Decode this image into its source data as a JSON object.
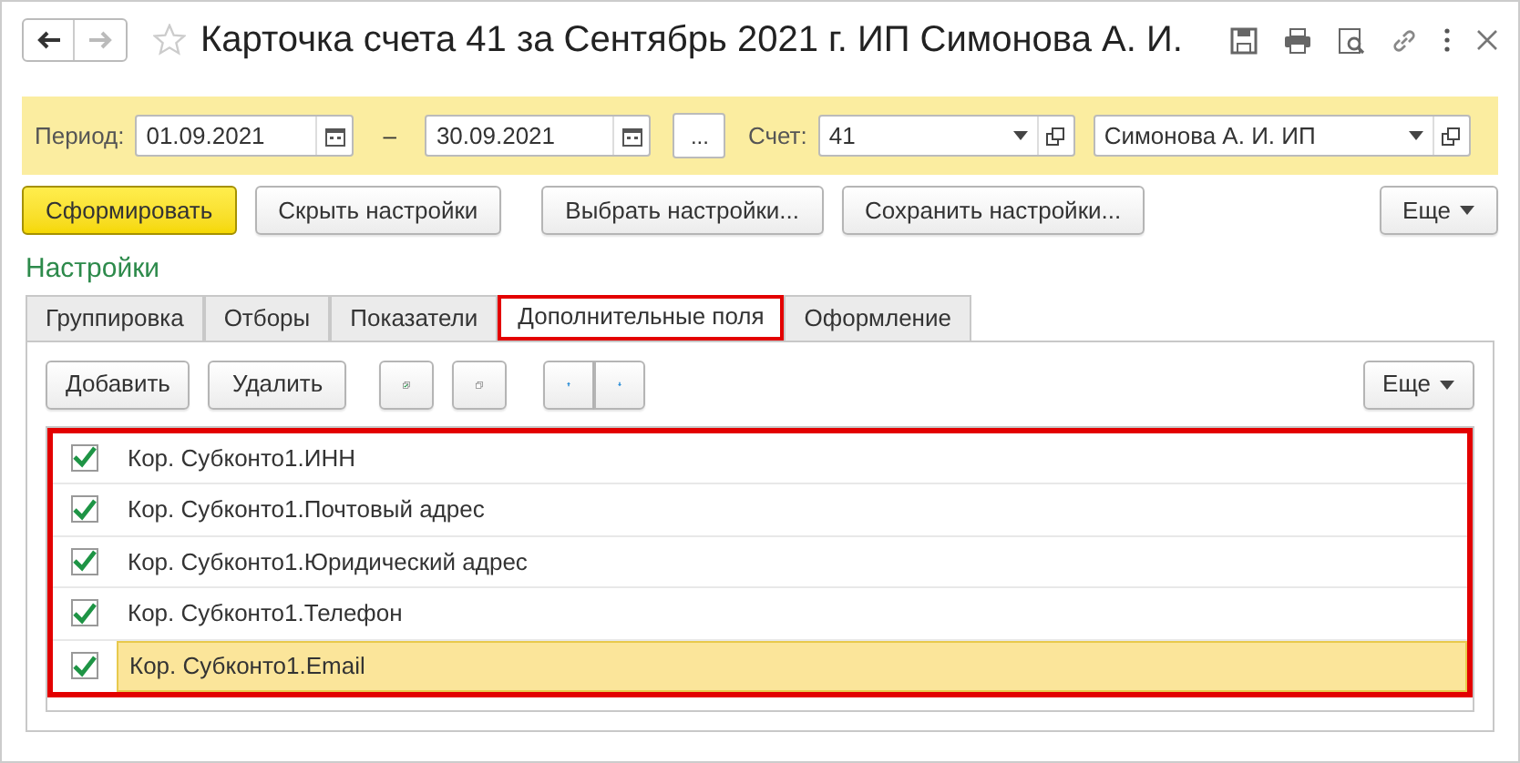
{
  "window": {
    "title": "Карточка счета 41 за Сентябрь 2021 г. ИП Симонова А. И.",
    "favorite": false
  },
  "filters": {
    "period_label": "Период:",
    "date_from": "01.09.2021",
    "dash": "–",
    "date_to": "30.09.2021",
    "more_button": "...",
    "account_label": "Счет:",
    "account": "41",
    "organization": "Симонова А. И. ИП"
  },
  "actions": [
    {
      "label": "Сформировать",
      "kind": "primary"
    },
    {
      "label": "Скрыть настройки",
      "kind": "normal"
    },
    {
      "label": "Выбрать настройки...",
      "kind": "normal"
    },
    {
      "label": "Сохранить настройки...",
      "kind": "normal"
    },
    {
      "label": "Еще",
      "kind": "menu"
    }
  ],
  "settings_title": "Настройки",
  "tabs": [
    {
      "label": "Группировка",
      "selected": false
    },
    {
      "label": "Отборы",
      "selected": false
    },
    {
      "label": "Показатели",
      "selected": false
    },
    {
      "label": "Дополнительные поля",
      "selected": true
    },
    {
      "label": "Оформление",
      "selected": false
    }
  ],
  "toolbar": {
    "add": "Добавить",
    "delete": "Удалить",
    "more": "Еще"
  },
  "fields": {
    "highlighted": true,
    "rows": [
      {
        "label": "Кор. Субконто1.ИНН",
        "checked": true,
        "selected": false
      },
      {
        "label": "Кор. Субконто1.Почтовый адрес",
        "checked": true,
        "selected": false
      },
      {
        "label": "Кор. Субконто1.Юридический адрес",
        "checked": true,
        "selected": false
      },
      {
        "label": "Кор. Субконто1.Телефон",
        "checked": true,
        "selected": false
      },
      {
        "label": "Кор. Субконто1.Email",
        "checked": true,
        "selected": true
      }
    ]
  }
}
